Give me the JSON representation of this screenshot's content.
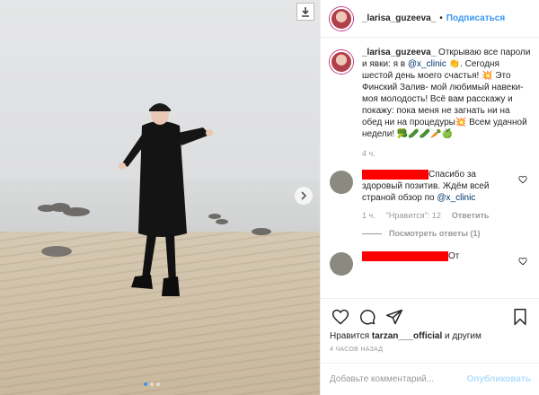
{
  "post": {
    "username": "_larisa_guzeeva_",
    "follow_label": "Подписаться",
    "header_separator": "•"
  },
  "caption": {
    "username": "_larisa_guzeeva_",
    "text_1": " Открываю все пароли и явки: я в ",
    "mention": "@x_clinic",
    "text_2": " 👏. Сегодня шестой день моего счастья! 💥 Это Финский Залив- мой любимый навеки- моя молодость! Всё вам расскажу и покажу: пока меня не загнать ни на обед ни на процедуры💥 Всем удачной недели! 🥦🥒🥒🥕🍏",
    "time": "4 ч."
  },
  "comments": [
    {
      "text_1": "Спасибо за здоровый позитив. Ждём всей страной обзор по ",
      "mention": "@x_clinic",
      "time": "1 ч.",
      "likes": "\"Нравится\": 12",
      "reply_label": "Ответить",
      "view_replies": "Посмотреть ответы (1)"
    },
    {
      "text_1": "От"
    }
  ],
  "likes": {
    "prefix": "Нравится ",
    "user": "tarzan___official",
    "suffix": " и другим"
  },
  "post_time": "4 ЧАСОВ НАЗАД",
  "comment_input": {
    "placeholder": "Добавьте комментарий...",
    "publish_label": "Опубликовать"
  },
  "colors": {
    "link": "#3897f0",
    "mention": "#003569",
    "redaction": "#ff0000"
  },
  "icons": [
    "download-icon",
    "chevron-right-icon",
    "heart-icon",
    "comment-icon",
    "share-icon",
    "bookmark-icon"
  ],
  "carousel": {
    "active_index": 0,
    "count": 3
  }
}
